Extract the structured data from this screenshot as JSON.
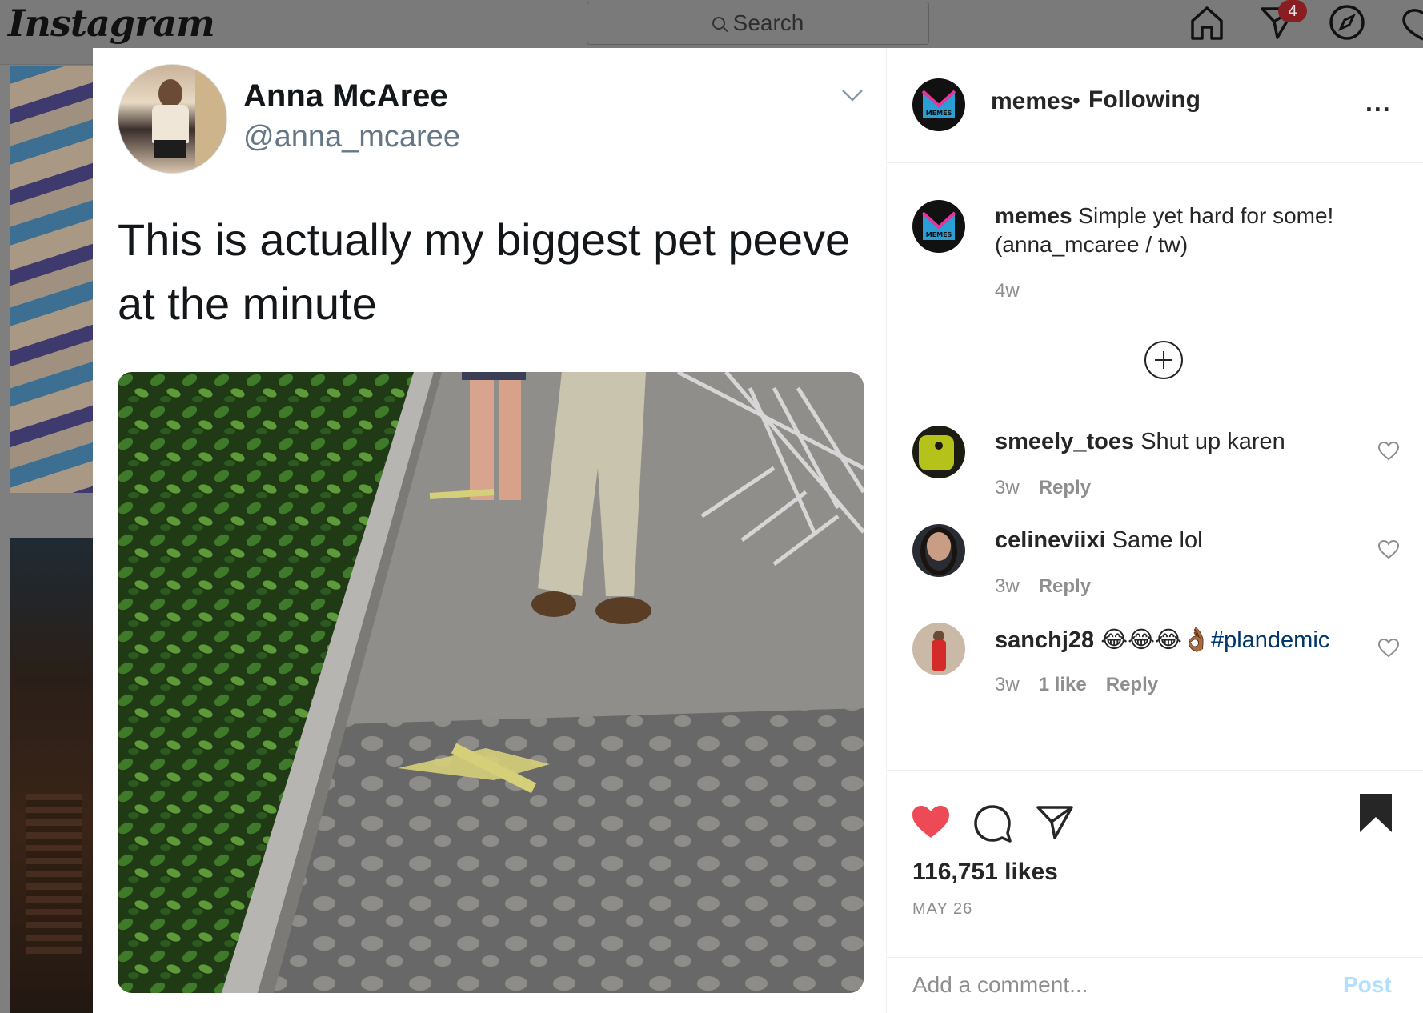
{
  "topbar": {
    "logo": "Instagram",
    "search_placeholder": "Search",
    "notifications_badge": "4"
  },
  "tweet": {
    "name": "Anna McAree",
    "handle": "@anna_mcaree",
    "text": "This is actually my biggest pet peeve at the minute"
  },
  "post": {
    "header": {
      "username": "memes",
      "separator": "•",
      "follow_status": "Following",
      "more": "..."
    },
    "avatar_label": "MEMES",
    "caption": {
      "username": "memes",
      "text": "Simple yet hard for some! (anna_mcaree / tw)",
      "time": "4w"
    },
    "comments": [
      {
        "username": "smeely_toes",
        "text": "Shut up karen",
        "time": "3w",
        "likes": "",
        "reply": "Reply"
      },
      {
        "username": "celineviixi",
        "text": "Same lol",
        "time": "3w",
        "likes": "",
        "reply": "Reply"
      },
      {
        "username": "sanchj28",
        "emoji": "😂😂😂👌🏾",
        "hashtag": "#plandemic",
        "time": "3w",
        "likes": "1 like",
        "reply": "Reply"
      }
    ],
    "likes": "116,751 likes",
    "date": "MAY 26",
    "add_comment_placeholder": "Add a comment...",
    "post_label": "Post"
  },
  "colors": {
    "like_red": "#ed4956",
    "link_blue": "#00376b",
    "post_disabled": "#b2dffc",
    "meta_gray": "#8e8e8e"
  }
}
